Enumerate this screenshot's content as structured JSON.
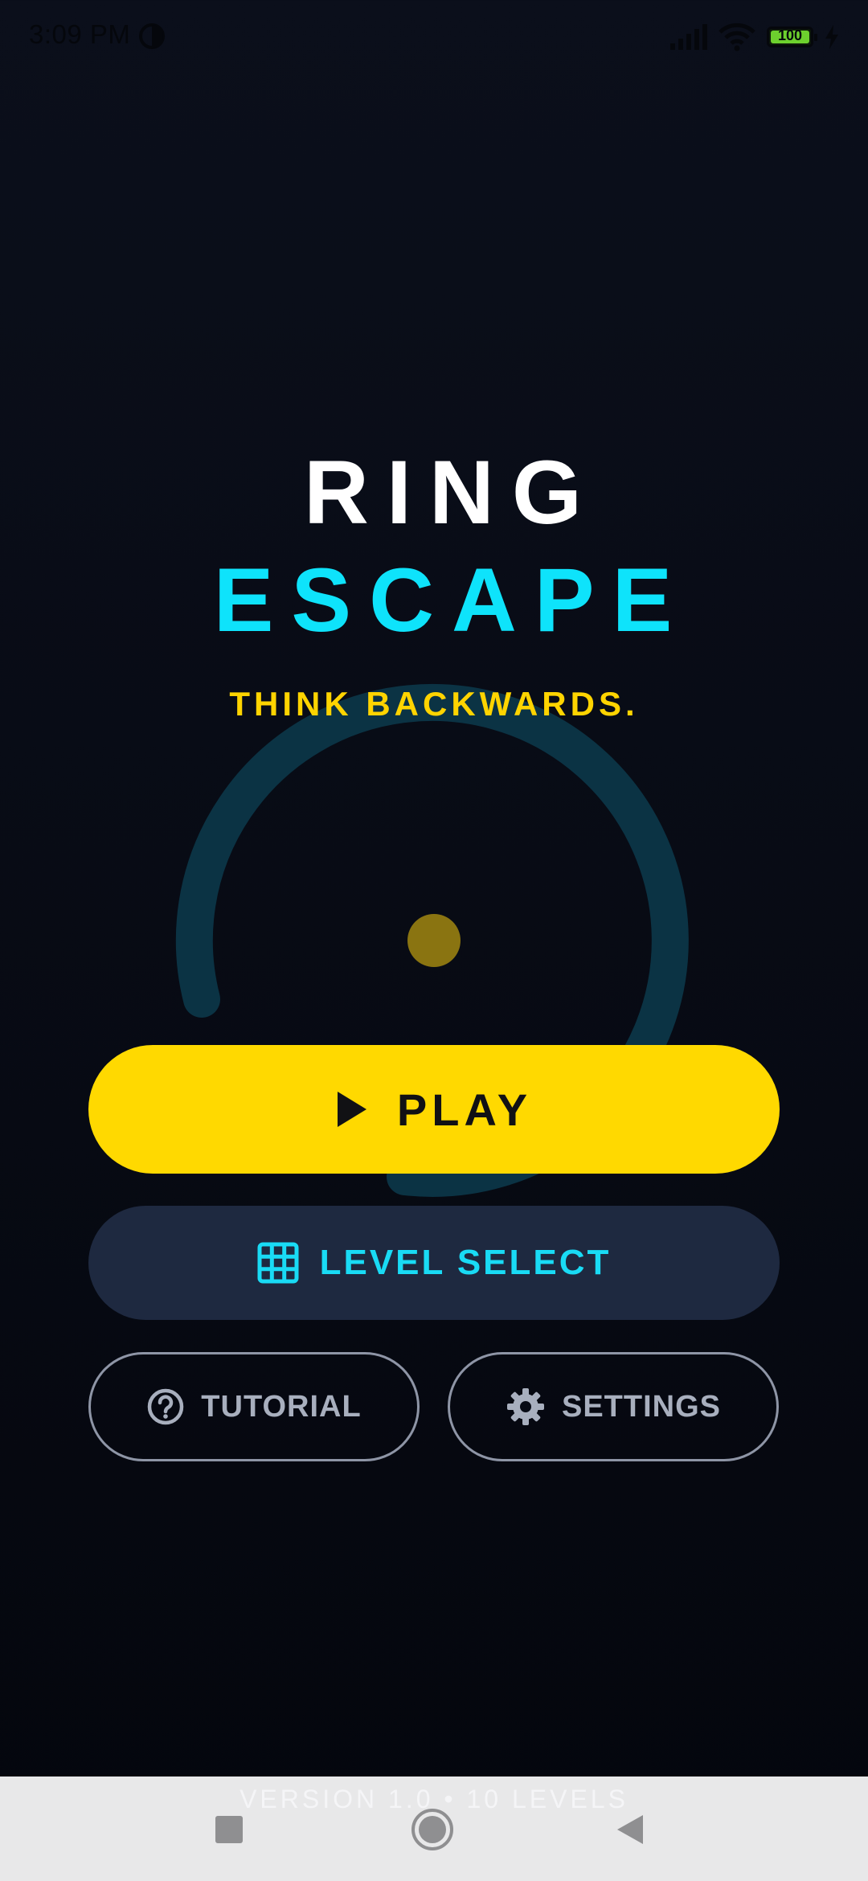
{
  "status_bar": {
    "time": "3:09 PM",
    "battery_level": "100",
    "battery_fraction": 1.0
  },
  "title": {
    "line1": "RING",
    "line2": "ESCAPE"
  },
  "tagline": "THINK BACKWARDS.",
  "buttons": {
    "play": "PLAY",
    "level_select": "LEVEL SELECT",
    "tutorial": "TUTORIAL",
    "settings": "SETTINGS"
  },
  "footer": {
    "version_text": "VERSION 1.0 • 10 LEVELS"
  },
  "icons": {
    "status": [
      "moon-icon",
      "signal-icon",
      "wifi-icon",
      "battery-icon",
      "charging-icon"
    ],
    "play": "play-icon",
    "level_select": "grid-icon",
    "tutorial": "help-circle-icon",
    "settings": "gear-icon",
    "nav": [
      "recent-apps-icon",
      "home-icon",
      "back-icon"
    ]
  },
  "colors": {
    "background": "#080b15",
    "title_primary": "#ffffff",
    "title_accent": "#0ee3fb",
    "tagline": "#ffd400",
    "play_button": "#ffd900",
    "level_select_button": "#1e2940",
    "level_select_text": "#19dbf5",
    "outline": "#8e95a6",
    "ring": "#0b3344",
    "ball": "#8a7411",
    "battery_fill": "#6dd02e"
  }
}
